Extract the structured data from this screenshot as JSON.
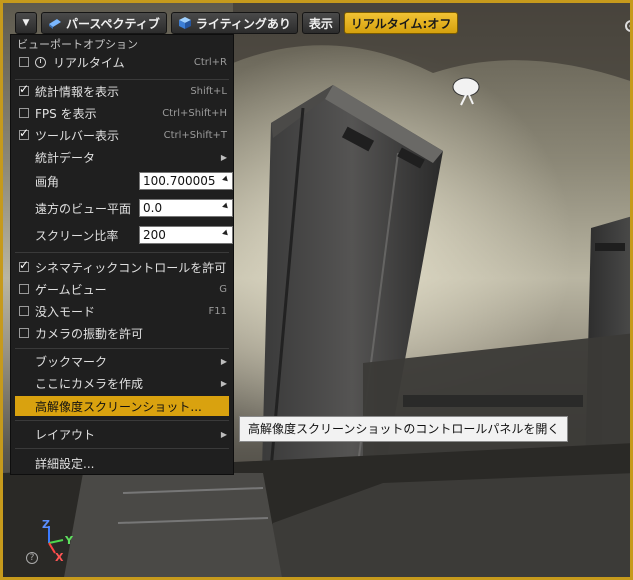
{
  "toolbar": {
    "perspective_label": "パースペクティブ",
    "lighting_label": "ライティングあり",
    "show_label": "表示",
    "realtime_label": "リアルタイム:オフ"
  },
  "menu": {
    "header": "ビューポートオプション",
    "items": {
      "realtime": {
        "label": "リアルタイム",
        "shortcut": "Ctrl+R",
        "checked": false
      },
      "stats": {
        "label": "統計情報を表示",
        "shortcut": "Shift+L",
        "checked": true
      },
      "fps": {
        "label": "FPS を表示",
        "shortcut": "Ctrl+Shift+H",
        "checked": false
      },
      "toolbar": {
        "label": "ツールバー表示",
        "shortcut": "Ctrl+Shift+T",
        "checked": true
      },
      "stat_data": {
        "label": "統計データ"
      },
      "fov": {
        "label": "画角",
        "value": "100.700005"
      },
      "far_plane": {
        "label": "遠方のビュー平面",
        "value": "0.0"
      },
      "screen_pct": {
        "label": "スクリーン比率",
        "value": "200"
      },
      "cinematic": {
        "label": "シネマティックコントロールを許可",
        "checked": true
      },
      "game_view": {
        "label": "ゲームビュー",
        "shortcut": "G",
        "checked": false
      },
      "immersive": {
        "label": "没入モード",
        "shortcut": "F11",
        "checked": false
      },
      "camera_shake": {
        "label": "カメラの振動を許可",
        "checked": false
      },
      "bookmarks": {
        "label": "ブックマーク"
      },
      "create_camera": {
        "label": "ここにカメラを作成"
      },
      "highres_screenshot": {
        "label": "高解像度スクリーンショット..."
      },
      "layout": {
        "label": "レイアウト"
      },
      "advanced": {
        "label": "詳細設定..."
      }
    }
  },
  "tooltip": {
    "text": "高解像度スクリーンショットのコントロールパネルを開く"
  },
  "gizmo": {
    "z": "Z",
    "y": "Y",
    "x": "X"
  },
  "help": {
    "glyph": "?"
  },
  "colors": {
    "accent": "#d9a20f",
    "border_gold": "#c69a1c",
    "menu_bg": "#1f1f1f"
  }
}
